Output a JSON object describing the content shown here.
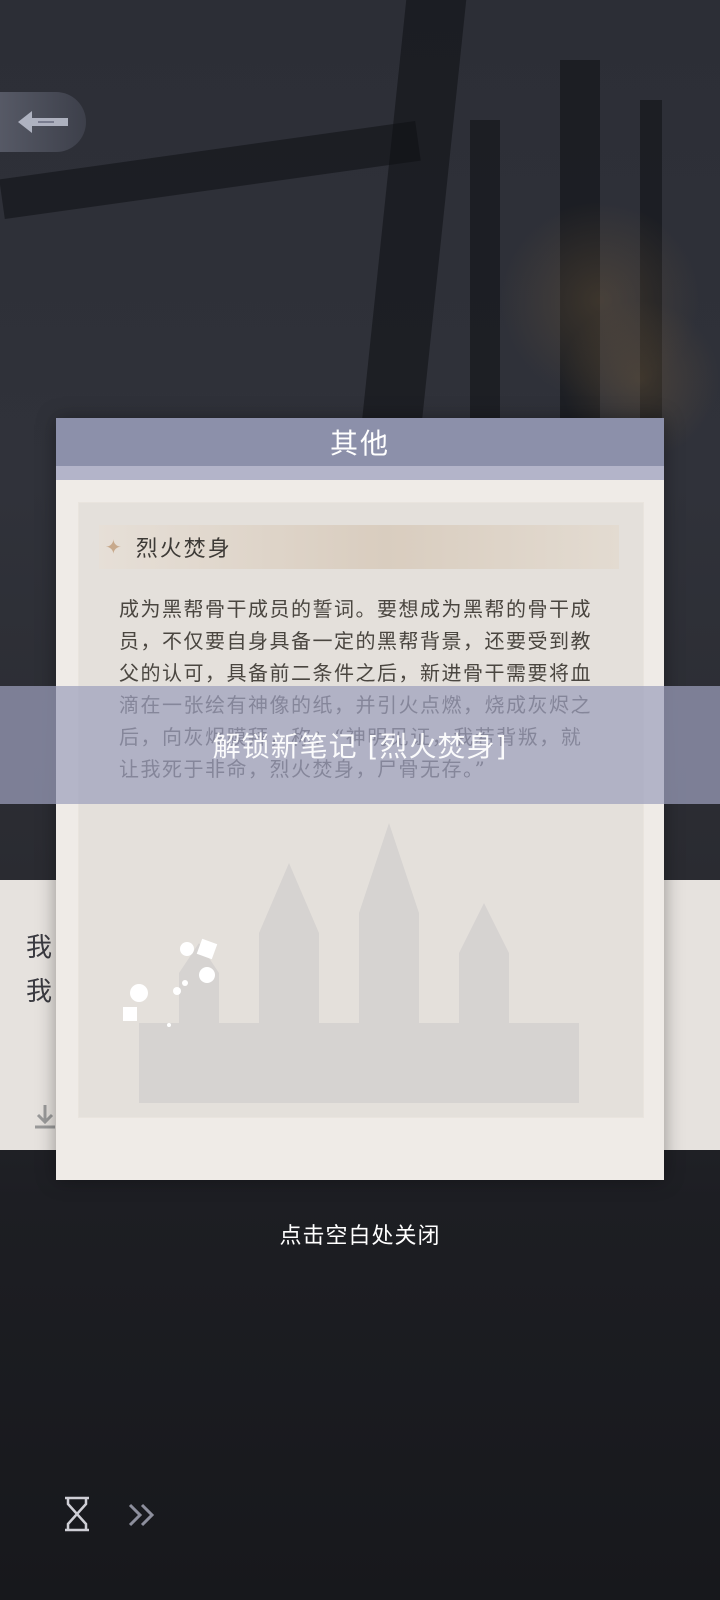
{
  "card": {
    "title": "其他",
    "note_title": "烈火焚身",
    "note_body": "成为黑帮骨干成员的誓词。要想成为黑帮的骨干成员，不仅要自身具备一定的黑帮背景，还要受到教父的认可，具备前二条件之后，新进骨干需要将血滴在一张绘有神像的纸，并引火点燃，烧成灰烬之后，向灰烬膜拜，称：“神明见证，我若背叛，就让我死于非命，烈火焚身，尸骨无存。”"
  },
  "banner": {
    "text": "解锁新笔记 [烈火焚身]"
  },
  "dialog": {
    "line1": "我",
    "line2": "我"
  },
  "close_hint": "点击空白处关闭",
  "icons": {
    "back": "back-arrow-icon",
    "download": "download-icon",
    "hourglass": "hourglass-icon",
    "skip": "skip-icon",
    "star": "star-icon"
  },
  "colors": {
    "header": "#8c90aa",
    "banner": "#9ca0bc",
    "card": "#efebe7"
  }
}
